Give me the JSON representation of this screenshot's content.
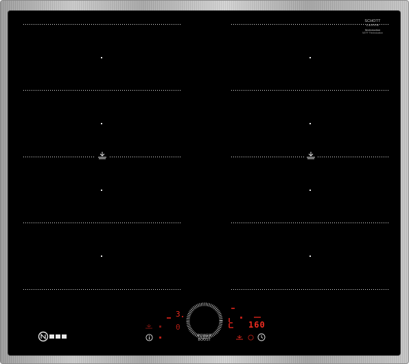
{
  "brand": {
    "glass_line1": "SCHOTT",
    "glass_line2": "CERAN",
    "glass_line3": "flexInduction",
    "glass_line4": "NEFF FlexInduction",
    "logo_text": "NEFF"
  },
  "controls": {
    "power_boost_line1": "POWER",
    "power_boost_line2": "BOOST",
    "left_level": "3",
    "left_zero": "0",
    "timer_display": "160",
    "info_symbol": "i"
  },
  "colors": {
    "glass": "#000000",
    "frame": "#b5b5b5",
    "led_red": "#e0281c",
    "print_white": "#e8e8e8"
  },
  "icons": {
    "flex_zone_symbol": "flex-zone-icon",
    "info": "info-icon",
    "clock": "clock-icon",
    "childlock": "childlock-icon",
    "power_dial": "slider-dial-icon"
  }
}
